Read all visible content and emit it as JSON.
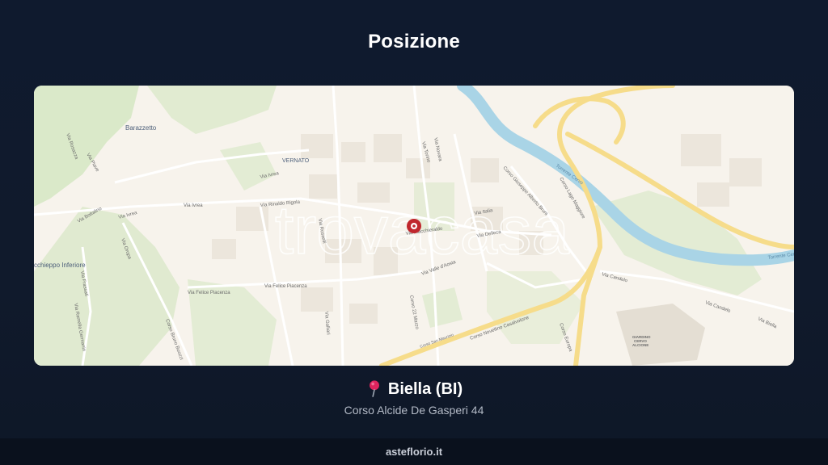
{
  "page": {
    "title": "Posizione",
    "location_name": "Biella (BI)",
    "address": "Corso Alcide De Gasperi 44",
    "footer": "asteflorio.it"
  },
  "map": {
    "watermark": "trovacasa",
    "labels": {
      "district_barazzetto": "Barazzetto",
      "district_vernato": "VERNATO",
      "district_chiavazza": "cchieppo Inferiore",
      "street_via_ivrea_1": "Via Ivrea",
      "street_via_ivrea_2": "Via Ivrea",
      "street_via_ivrea_3": "Via Ivrea",
      "street_via_rigola": "Via Rinaldo Rigola",
      "street_via_rosselli": "Via Rosselli",
      "street_via_torino": "Via Torino",
      "street_via_novara": "Via Novara",
      "street_via_italia": "Via Italia",
      "street_via_macchieraldo": "Via Macchieraldo",
      "street_via_delleca": "Via Delleca",
      "street_via_aosta": "Via Valle d'Aosta",
      "street_corso_22_marzo": "Corso 22 Marzo",
      "street_via_felice_piacenza_1": "Via Felice Piacenza",
      "street_via_felice_piacenza_2": "Via Felice Piacenza",
      "street_corso_novellino": "Corso Novellino Casalvolone",
      "street_corso_san_maurizio": "Corso San Maurizio",
      "street_corso_rivetti": "Corso Bruno Buozzi",
      "street_corso_europa": "Corso Europa",
      "street_corso_carlo_alberto": "Corso Giuseppe Alberto Bruni",
      "street_corso_lago_maggiore": "Corso Lago Maggiore",
      "street_via_candelo_1": "Via Candelo",
      "street_via_candelo_2": "Via Candelo",
      "street_via_biella": "Via Biella",
      "street_via_oropa": "Via Oropa",
      "street_via_bottalino": "Via Bottalino",
      "street_via_rosazza": "Via Rosazza",
      "street_via_frassati": "Via Frassati",
      "street_via_delle_rose": "Via Ramella Germanin",
      "street_via_piave": "Via Piave",
      "street_via_galliari": "Via Galliari",
      "river_cervo_1": "Torrente Cervo",
      "river_cervo_2": "Torrente Cervo",
      "giardino_1": "GIARDINO",
      "giardino_2": "CERVO",
      "giardino_3": "ALCIONE"
    },
    "marker_color": "#c0272d",
    "road_major_color": "#f6dc8a",
    "river_color": "#a9d4e6",
    "park_color": "#d9e8c8"
  },
  "colors": {
    "background": "#0f1a2e",
    "footer_background": "#0a111d",
    "pin_icon": "#e0245e"
  }
}
